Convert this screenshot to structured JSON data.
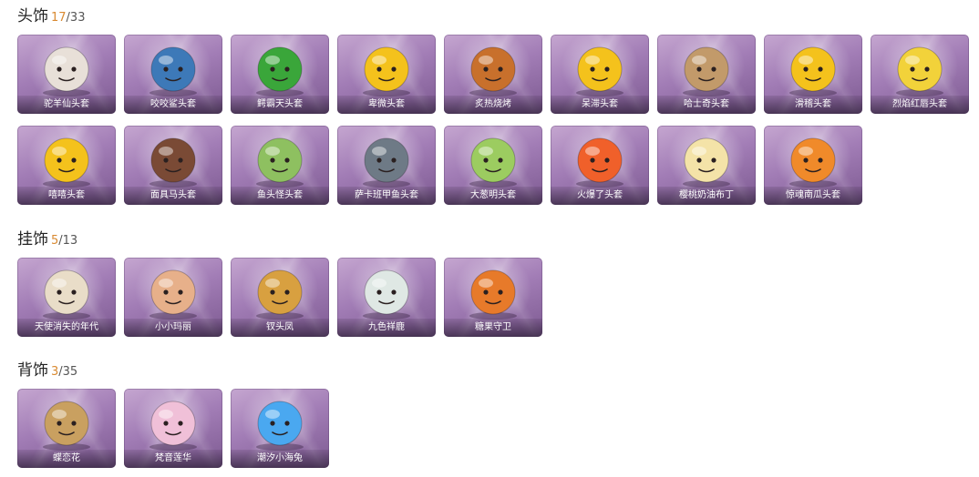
{
  "sections": [
    {
      "title": "头饰",
      "owned": "17",
      "total": "/33",
      "items": [
        {
          "label": "驼羊仙头套",
          "icon": "raccoon-mask-icon",
          "color": "#e8e0d8"
        },
        {
          "label": "咬咬鲨头套",
          "icon": "shark-head-icon",
          "color": "#3d79b8"
        },
        {
          "label": "鳄霸天头套",
          "icon": "crocodile-head-icon",
          "color": "#3aa63a"
        },
        {
          "label": "卑微头套",
          "icon": "shy-emoji-head-icon",
          "color": "#f4c21c"
        },
        {
          "label": "炙热烧烤",
          "icon": "grilled-meat-icon",
          "color": "#c8702c"
        },
        {
          "label": "呆滞头套",
          "icon": "dazed-emoji-head-icon",
          "color": "#f4c21c"
        },
        {
          "label": "哈士奇头套",
          "icon": "husky-head-icon",
          "color": "#c29a6a"
        },
        {
          "label": "滑稽头套",
          "icon": "funny-emoji-head-icon",
          "color": "#f4c21c"
        },
        {
          "label": "烈焰红唇头套",
          "icon": "pikachu-head-icon",
          "color": "#f2d23a"
        },
        {
          "label": "嘻嘻头套",
          "icon": "grin-emoji-head-icon",
          "color": "#f4c21c"
        },
        {
          "label": "面具马头套",
          "icon": "horse-mask-icon",
          "color": "#7a4a35"
        },
        {
          "label": "鱼头怪头套",
          "icon": "fish-head-icon",
          "color": "#8ec060"
        },
        {
          "label": "萨卡班甲鱼头套",
          "icon": "sacabambaspis-head-icon",
          "color": "#6e7a86"
        },
        {
          "label": "大葱明头套",
          "icon": "green-onion-head-icon",
          "color": "#9ccc60"
        },
        {
          "label": "火爆了头套",
          "icon": "fire-spirit-head-icon",
          "color": "#f0602a"
        },
        {
          "label": "樱桃奶油布丁",
          "icon": "cherry-pudding-icon",
          "color": "#f4e3a8"
        },
        {
          "label": "惊魂南瓜头套",
          "icon": "pumpkin-head-icon",
          "color": "#f08a2a"
        }
      ]
    },
    {
      "title": "挂饰",
      "owned": "5",
      "total": "/13",
      "items": [
        {
          "label": "天使消失的年代",
          "icon": "angel-figure-icon",
          "color": "#e9ddc8"
        },
        {
          "label": "小小玛丽",
          "icon": "mary-doll-icon",
          "color": "#e7b08a"
        },
        {
          "label": "钗头凤",
          "icon": "phoenix-hairpin-figure-icon",
          "color": "#d8a040"
        },
        {
          "label": "九色祥鹿",
          "icon": "nine-color-deer-icon",
          "color": "#dfe8e4"
        },
        {
          "label": "糖果守卫",
          "icon": "candy-guard-icon",
          "color": "#e77a2a"
        }
      ]
    },
    {
      "title": "背饰",
      "owned": "3",
      "total": "/35",
      "items": [
        {
          "label": "蝶恋花",
          "icon": "butterfly-flower-icon",
          "color": "#c9a060"
        },
        {
          "label": "梵音莲华",
          "icon": "lotus-girl-icon",
          "color": "#f0c0d8"
        },
        {
          "label": "潮汐小海兔",
          "icon": "sea-bunny-icon",
          "color": "#4aa8f0"
        }
      ]
    }
  ]
}
